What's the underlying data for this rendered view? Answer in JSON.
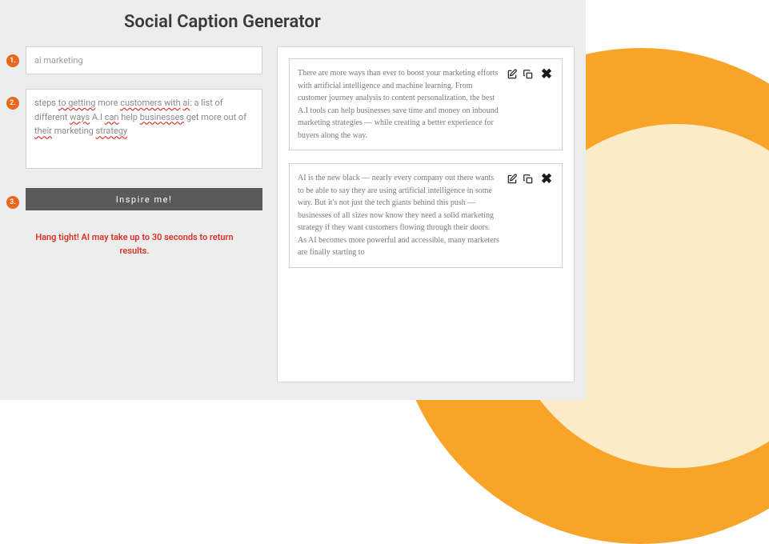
{
  "title": "Social Caption Generator",
  "steps": {
    "step1": {
      "badge": "1.",
      "value": "ai marketing"
    },
    "step2": {
      "badge": "2.",
      "value": "steps to getting more customers with ai: a list of different ways A.I can help businesses get more out of their marketing strategy"
    },
    "step3": {
      "badge": "3.",
      "button_label": "Inspire me!"
    }
  },
  "status_message": "Hang tight! AI may take up to 30 seconds to return results.",
  "results": [
    {
      "text": "There are more ways than ever to boost your marketing efforts with artificial intelligence and machine learning. From customer journey analysis to content personalization, the best A.I tools can help businesses save time and money on inbound marketing strategies — while creating a better experience for buyers along the way."
    },
    {
      "text": "AI is the new black — nearly every company out there wants to be able to say they are using artificial intelligence in some way. But it's not just the tech giants behind this push — businesses of all sizes now know they need a solid marketing strategy if they want customers flowing through their doors. As AI becomes more powerful and accessible, many marketers are finally starting to"
    }
  ],
  "icons": {
    "edit": "edit-icon",
    "copy": "copy-icon",
    "close": "close-icon"
  },
  "spellcheck_words": [
    "to getting",
    "customers with",
    "ai",
    "ways",
    "can",
    "businesses",
    "their",
    "strategy"
  ]
}
